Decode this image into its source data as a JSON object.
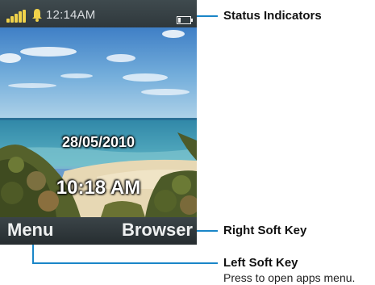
{
  "status_bar": {
    "time": "12:14AM",
    "signal_icon": "signal-strength-icon",
    "alarm_icon": "bell-icon",
    "battery_icon": "battery-icon"
  },
  "home_screen": {
    "date": "28/05/2010",
    "clock": "10:18 AM",
    "wallpaper": "beach-scene"
  },
  "softkeys": {
    "left": "Menu",
    "right": "Browser"
  },
  "callouts": {
    "status_indicators": "Status Indicators",
    "right_soft_key": "Right Soft Key",
    "left_soft_key": "Left Soft Key",
    "left_soft_key_desc": "Press to open apps menu."
  },
  "colors": {
    "callout_line": "#1a86c8",
    "signal_bars": "#f0d24a",
    "status_bar_bg": "#3a4448"
  }
}
